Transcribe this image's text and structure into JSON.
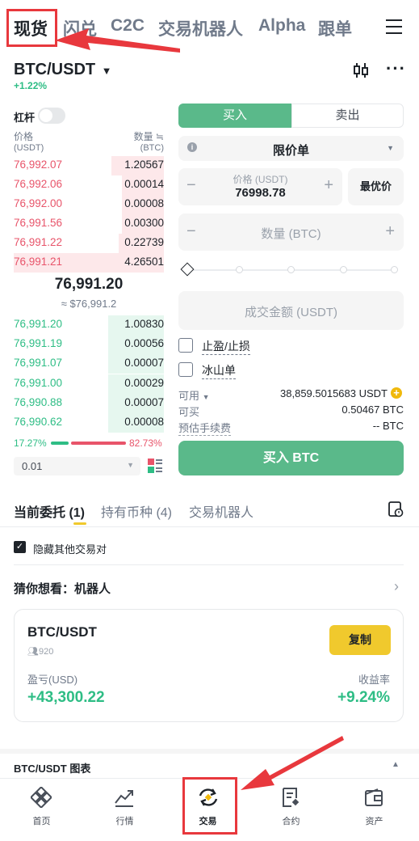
{
  "top_tabs": [
    "现货",
    "闪兑",
    "C2C",
    "交易机器人",
    "Alpha",
    "跟单"
  ],
  "pair": {
    "symbol": "BTC/USDT",
    "change": "+1.22%"
  },
  "leverage_label": "杠杆",
  "order_book": {
    "price_header": "价格",
    "price_unit": "(USDT)",
    "qty_header": "数量 ≒",
    "qty_unit": "(BTC)",
    "asks": [
      {
        "price": "76,992.07",
        "qty": "1.20567",
        "depth": 0.35
      },
      {
        "price": "76,992.06",
        "qty": "0.00014",
        "depth": 0.28
      },
      {
        "price": "76,992.00",
        "qty": "0.00008",
        "depth": 0.28
      },
      {
        "price": "76,991.56",
        "qty": "0.00300",
        "depth": 0.28
      },
      {
        "price": "76,991.22",
        "qty": "0.22739",
        "depth": 0.3
      },
      {
        "price": "76,991.21",
        "qty": "4.26501",
        "depth": 1.0
      }
    ],
    "mid_price": "76,991.20",
    "mid_sub": "≈ $76,991.2",
    "bids": [
      {
        "price": "76,991.20",
        "qty": "1.00830",
        "depth": 0.37
      },
      {
        "price": "76,991.19",
        "qty": "0.00056",
        "depth": 0.37
      },
      {
        "price": "76,991.07",
        "qty": "0.00007",
        "depth": 0.37
      },
      {
        "price": "76,991.00",
        "qty": "0.00029",
        "depth": 0.37
      },
      {
        "price": "76,990.88",
        "qty": "0.00007",
        "depth": 0.37
      },
      {
        "price": "76,990.62",
        "qty": "0.00008",
        "depth": 0.37
      }
    ],
    "buy_ratio": "17.27%",
    "sell_ratio": "82.73%",
    "precision": "0.01"
  },
  "order_form": {
    "buy_tab": "买入",
    "sell_tab": "卖出",
    "order_type": "限价单",
    "price_label": "价格 (USDT)",
    "price_value": "76998.78",
    "best_price": "最优价",
    "qty_placeholder": "数量 (BTC)",
    "total_placeholder": "成交金额 (USDT)",
    "tp_sl": "止盈/止损",
    "iceberg": "冰山单",
    "available_label": "可用",
    "available_value": "38,859.5015683 USDT",
    "can_buy_label": "可买",
    "can_buy_value": "0.50467 BTC",
    "fee_label": "预估手续费",
    "fee_value": "-- BTC",
    "buy_button": "买入 BTC"
  },
  "orders_tabs": {
    "open": "当前委托 (1)",
    "holdings": "持有币种 (4)",
    "bots": "交易机器人"
  },
  "hide_other": "隐藏其他交易对",
  "suggest": {
    "title": "猜你想看：机器人"
  },
  "bot_card": {
    "pair": "BTC/USDT",
    "followers": "920",
    "copy_button": "复制",
    "pnl_label": "盈亏(USD)",
    "pnl_value": "+43,300.22",
    "roi_label": "收益率",
    "roi_value": "+9.24%"
  },
  "chart_bar": "BTC/USDT 图表",
  "bottom_nav": [
    "首页",
    "行情",
    "交易",
    "合约",
    "资产"
  ],
  "colors": {
    "green": "#2ebd85",
    "red": "#e8546a",
    "yellow": "#f0c92d",
    "annotation": "#e8383d"
  }
}
